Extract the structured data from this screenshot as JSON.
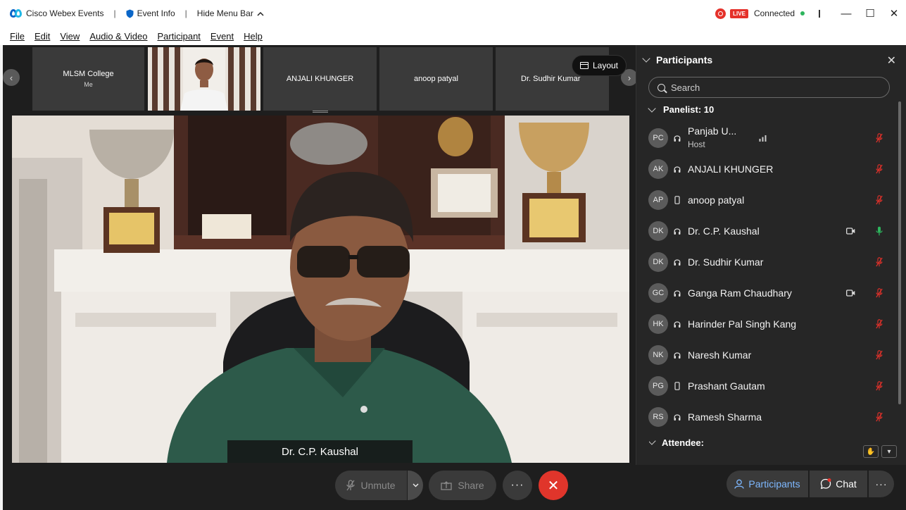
{
  "titlebar": {
    "app_name": "Cisco Webex Events",
    "event_info": "Event Info",
    "hide_menu_bar": "Hide Menu Bar",
    "live": "LIVE",
    "status": "Connected",
    "brand_color": "#0a66c8",
    "live_color": "#e5312a",
    "status_color": "#2db55d"
  },
  "menu": [
    "File",
    "Edit",
    "View",
    "Audio & Video",
    "Participant",
    "Event",
    "Help"
  ],
  "thumbnails": [
    {
      "name": "MLSM College",
      "sub": "Me"
    },
    {
      "name": "",
      "sub": ""
    },
    {
      "name": "ANJALI KHUNGER",
      "sub": ""
    },
    {
      "name": "anoop patyal",
      "sub": ""
    },
    {
      "name": "Dr. Sudhir Kumar",
      "sub": ""
    }
  ],
  "layout_button": "Layout",
  "main_speaker": "Dr. C.P. Kaushal",
  "panel": {
    "title": "Participants",
    "search_placeholder": "Search",
    "group_label": "Panelist: 10",
    "attendee_label": "Attendee:",
    "participants": [
      {
        "initials": "PC",
        "name": "Panjab U...",
        "role": "Host",
        "audio": "headset",
        "camera": false,
        "mic": "muted"
      },
      {
        "initials": "AK",
        "name": "ANJALI KHUNGER",
        "role": "",
        "audio": "headset",
        "camera": false,
        "mic": "muted"
      },
      {
        "initials": "AP",
        "name": "anoop patyal",
        "role": "",
        "audio": "phone",
        "camera": false,
        "mic": "muted"
      },
      {
        "initials": "DK",
        "name": "Dr. C.P. Kaushal",
        "role": "",
        "audio": "headset",
        "camera": true,
        "mic": "active"
      },
      {
        "initials": "DK",
        "name": "Dr. Sudhir Kumar",
        "role": "",
        "audio": "headset",
        "camera": false,
        "mic": "muted"
      },
      {
        "initials": "GC",
        "name": "Ganga Ram Chaudhary",
        "role": "",
        "audio": "headset",
        "camera": true,
        "mic": "muted"
      },
      {
        "initials": "HK",
        "name": "Harinder Pal Singh Kang",
        "role": "",
        "audio": "headset",
        "camera": false,
        "mic": "muted"
      },
      {
        "initials": "NK",
        "name": "Naresh Kumar",
        "role": "",
        "audio": "headset",
        "camera": false,
        "mic": "muted"
      },
      {
        "initials": "PG",
        "name": "Prashant Gautam",
        "role": "",
        "audio": "phone",
        "camera": false,
        "mic": "muted"
      },
      {
        "initials": "RS",
        "name": "Ramesh Sharma",
        "role": "",
        "audio": "headset",
        "camera": false,
        "mic": "muted"
      }
    ],
    "muted_color": "#e5312a",
    "active_mic_color": "#2db55d"
  },
  "controls": {
    "unmute": "Unmute",
    "share": "Share",
    "participants": "Participants",
    "chat": "Chat",
    "end_color": "#e0352b",
    "accent_color": "#7eb8ff"
  }
}
